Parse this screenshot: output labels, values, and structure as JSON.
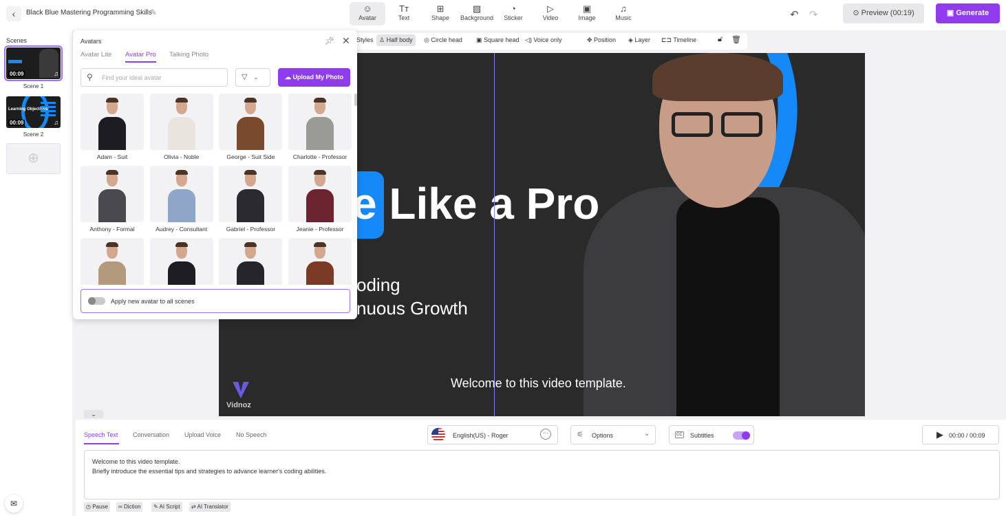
{
  "header": {
    "title": "Black Blue Mastering Programming Skills",
    "tools": [
      {
        "label": "Avatar",
        "icon": "avatar-icon",
        "active": true
      },
      {
        "label": "Text",
        "icon": "text-icon"
      },
      {
        "label": "Shape",
        "icon": "shape-icon"
      },
      {
        "label": "Background",
        "icon": "background-icon"
      },
      {
        "label": "Sticker",
        "icon": "sticker-icon"
      },
      {
        "label": "Video",
        "icon": "video-icon"
      },
      {
        "label": "Image",
        "icon": "image-icon"
      },
      {
        "label": "Music",
        "icon": "music-icon"
      }
    ],
    "preview": "Preview (00:19)",
    "generate": "Generate"
  },
  "scenes": {
    "title": "Scenes",
    "items": [
      {
        "label": "Scene 1",
        "duration": "00:09"
      },
      {
        "label": "Scene 2",
        "duration": "00:09"
      }
    ]
  },
  "context_bar": {
    "styles": "Styles",
    "half_body": "Half body",
    "circle_head": "Circle head",
    "square_head": "Square head",
    "voice_only": "Voice only",
    "position": "Position",
    "layer": "Layer",
    "timeline": "Timeline"
  },
  "avatars_panel": {
    "title": "Avatars",
    "tabs": [
      "Avatar Lite",
      "Avatar Pro",
      "Talking Photo"
    ],
    "active_tab": "Avatar Pro",
    "search_placeholder": "Find your ideal avatar",
    "upload": "Upload My Photo",
    "apply_all": "Apply new avatar to all scenes",
    "apply_all_on": false,
    "avatars": [
      {
        "name": "Adam - Suit",
        "outfit": "#1c1c22"
      },
      {
        "name": "Olivia - Noble",
        "outfit": "#e9e4de"
      },
      {
        "name": "George - Suit Side",
        "outfit": "#7a4a2c"
      },
      {
        "name": "Charlotte - Professor",
        "outfit": "#9a9a96"
      },
      {
        "name": "Anthony - Formal",
        "outfit": "#4a4a4e"
      },
      {
        "name": "Audrey - Consultant",
        "outfit": "#8fa6c9"
      },
      {
        "name": "Gabriel - Professor",
        "outfit": "#2a2a30"
      },
      {
        "name": "Jeanie - Professor",
        "outfit": "#6b2430"
      },
      {
        "name": "",
        "outfit": "#b49a7c"
      },
      {
        "name": "",
        "outfit": "#1e1e22"
      },
      {
        "name": "",
        "outfit": "#25252b"
      },
      {
        "name": "",
        "outfit": "#7a3a26"
      }
    ]
  },
  "canvas": {
    "headline": "e Like a Pro",
    "line1": "oding",
    "line2": "nuous Growth",
    "subtitle": "Welcome to this video template.",
    "logo": "Vidnoz",
    "accent": "#1589f7"
  },
  "speech": {
    "tabs": [
      "Speech Text",
      "Conversation",
      "Upload Voice",
      "No Speech"
    ],
    "active_tab": "Speech Text",
    "voice": "English(US) - Roger",
    "options": "Options",
    "subtitles": "Subtitles",
    "subtitles_on": true,
    "time": "00:00 / 00:09",
    "text_line1": "Welcome to this video template.",
    "text_line2": "Briefly introduce the essential tips and strategies to advance learner's coding abilities.",
    "chips": [
      "Pause",
      "Diction",
      "AI Script",
      "AI Translator"
    ]
  }
}
